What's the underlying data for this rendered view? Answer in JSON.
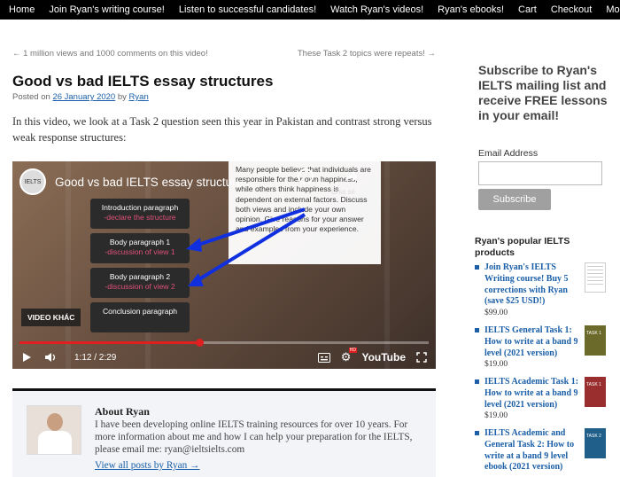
{
  "nav": {
    "items": [
      "Home",
      "Join Ryan's writing course!",
      "Listen to successful candidates!",
      "Watch Ryan's videos!",
      "Ryan's ebooks!",
      "Cart",
      "Checkout",
      "More..."
    ]
  },
  "postnav": {
    "prev": "← 1 million views and 1000 comments on this video!",
    "next": "These Task 2 topics were repeats! →"
  },
  "post": {
    "title": "Good vs bad IELTS essay structures",
    "posted_on": "Posted on",
    "date": "26 January 2020",
    "by": "by",
    "author": "Ryan",
    "intro": "In this video, we look at a Task 2 question seen this year in Pakistan and contrast strong versus weak response structures:"
  },
  "video": {
    "title": "Good vs bad IELTS essay structures",
    "avatar_label": "IELTS",
    "card_text": "Many people believe that individuals are responsible for their own happiness, while others think happiness is dependent on external factors. Discuss both views and include your own opinion. Give reasons for your answer and examples from your experience.",
    "share_label": "Chia sẻ",
    "boxes": [
      {
        "title": "Introduction paragraph",
        "sub": "-declare the structure"
      },
      {
        "title": "Body paragraph 1",
        "sub": "-discussion of view 1"
      },
      {
        "title": "Body paragraph 2",
        "sub": "-discussion of view 2"
      },
      {
        "title": "Conclusion paragraph",
        "sub": ""
      }
    ],
    "badge": "VIDEO KHÁC",
    "time": "1:12 / 2:29",
    "progress": 0.44,
    "yt": "YouTube",
    "hd": "HD"
  },
  "about": {
    "heading": "About Ryan",
    "text": "I have been developing online IELTS training resources for over 10 years. For more information about me and how I can help your preparation for the IELTS, please email me: ryan@ieltsielts.com",
    "link": "View all posts by Ryan →"
  },
  "sidebar": {
    "subscribe_title": "Subscribe to Ryan's IELTS mailing list and receive FREE lessons in your email!",
    "email_label": "Email Address",
    "subscribe_button": "Subscribe",
    "popular_title": "Ryan's popular IELTS products",
    "products": [
      {
        "name": "Join Ryan's IELTS Writing course! Buy 5 corrections with Ryan (save $25 USD!)",
        "price": "$99.00"
      },
      {
        "name": "IELTS General Task 1: How to write at a band 9 level (2021 version)",
        "price": "$19.00"
      },
      {
        "name": "IELTS Academic Task 1: How to write at a band 9 level (2021 version)",
        "price": "$19.00"
      },
      {
        "name": "IELTS Academic and General Task 2: How to write at a band 9 level ebook (2021 version)",
        "price": ""
      }
    ],
    "book_labels": [
      "TASK 1",
      "TASK 1",
      "TASK 2"
    ]
  }
}
